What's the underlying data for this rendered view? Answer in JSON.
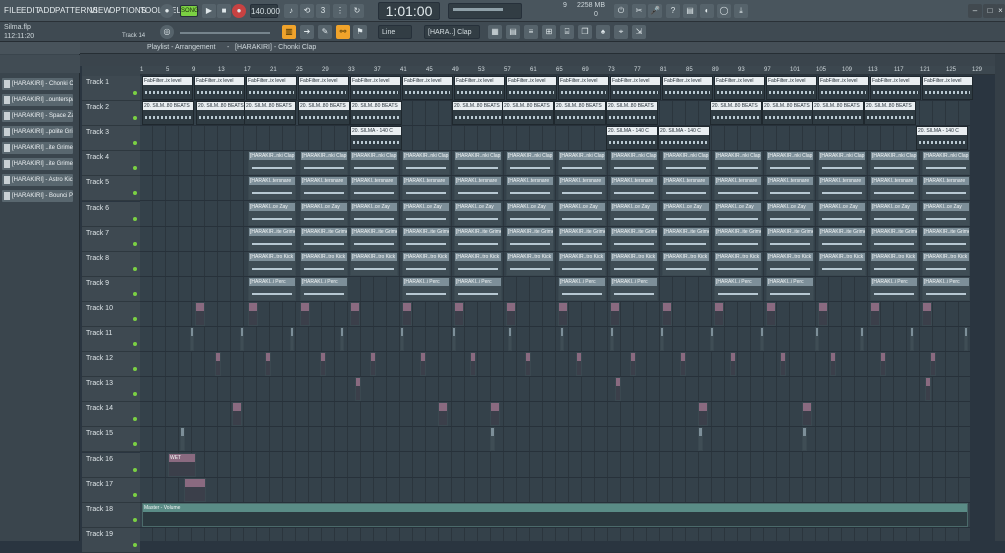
{
  "menu": [
    "FILE",
    "EDIT",
    "ADD",
    "PATTERNS",
    "VIEW",
    "OPTIONS",
    "TOOLS",
    "HELP"
  ],
  "title": {
    "project": "Silma.flp",
    "time_hint": "112:11:20",
    "track_hint": "Track 14"
  },
  "transport": {
    "mode": "SONG",
    "tempo": "140.000",
    "time": "1:01:00",
    "time_units": "M:S:CS",
    "cpu": "9",
    "ram": "2258 MB",
    "ram2": "0"
  },
  "toolbar2": {
    "snap": "Line",
    "channel_name": "[HARA..] Clap"
  },
  "playlist": {
    "title": "Playlist - Arrangement",
    "pattern": "[HARAKIRI] - Chonki Clap"
  },
  "patterns": [
    "[HARAKIRI] - Chonki Clap",
    "[HARAKIRI] ..ounterspace",
    "[HARAKIRI] - Space Zay",
    "[HARAKIRI] ..polite Grime",
    "[HARAKIRI] ..ite Grime #2",
    "[HARAKIRI] ..ite Grime #3",
    "[HARAKIRI] - Astro Kick",
    "[HARAKIRI] - Bounci Perc"
  ],
  "ruler": [
    "1",
    "5",
    "9",
    "13",
    "17",
    "21",
    "25",
    "29",
    "33",
    "37",
    "41",
    "45",
    "49",
    "53",
    "57",
    "61",
    "65",
    "69",
    "73",
    "77",
    "81",
    "85",
    "89",
    "93",
    "97",
    "101",
    "105",
    "109",
    "113",
    "117",
    "121",
    "125",
    "129"
  ],
  "tracks": [
    "Track 1",
    "Track 2",
    "Track 3",
    "Track 4",
    "Track 5",
    "Track 6",
    "Track 7",
    "Track 8",
    "Track 9",
    "Track 10",
    "Track 11",
    "Track 12",
    "Track 13",
    "Track 14",
    "Track 15",
    "Track 16",
    "Track 17",
    "Track 18",
    "Track 19"
  ],
  "clips": {
    "t1": "FabFilter..ix level",
    "t2": "20. SILM..80 BEATS",
    "t3": "20. SILMA - 140 C",
    "t4": "[HARAKIR..nki Clap",
    "t5": "[HARAKI..tersnare",
    "t6": "[HARAKI..ce Zay",
    "t7": "[HARAKIR..ite Grime",
    "t8": "[HARAKIR..tro Kick",
    "t9": "[HARAKI..i Perc",
    "t16": "WET",
    "t18": "Master - Volume"
  },
  "colors": {
    "accent": "#7bd143",
    "clip": "#5c6e78",
    "record": "#e04040"
  }
}
